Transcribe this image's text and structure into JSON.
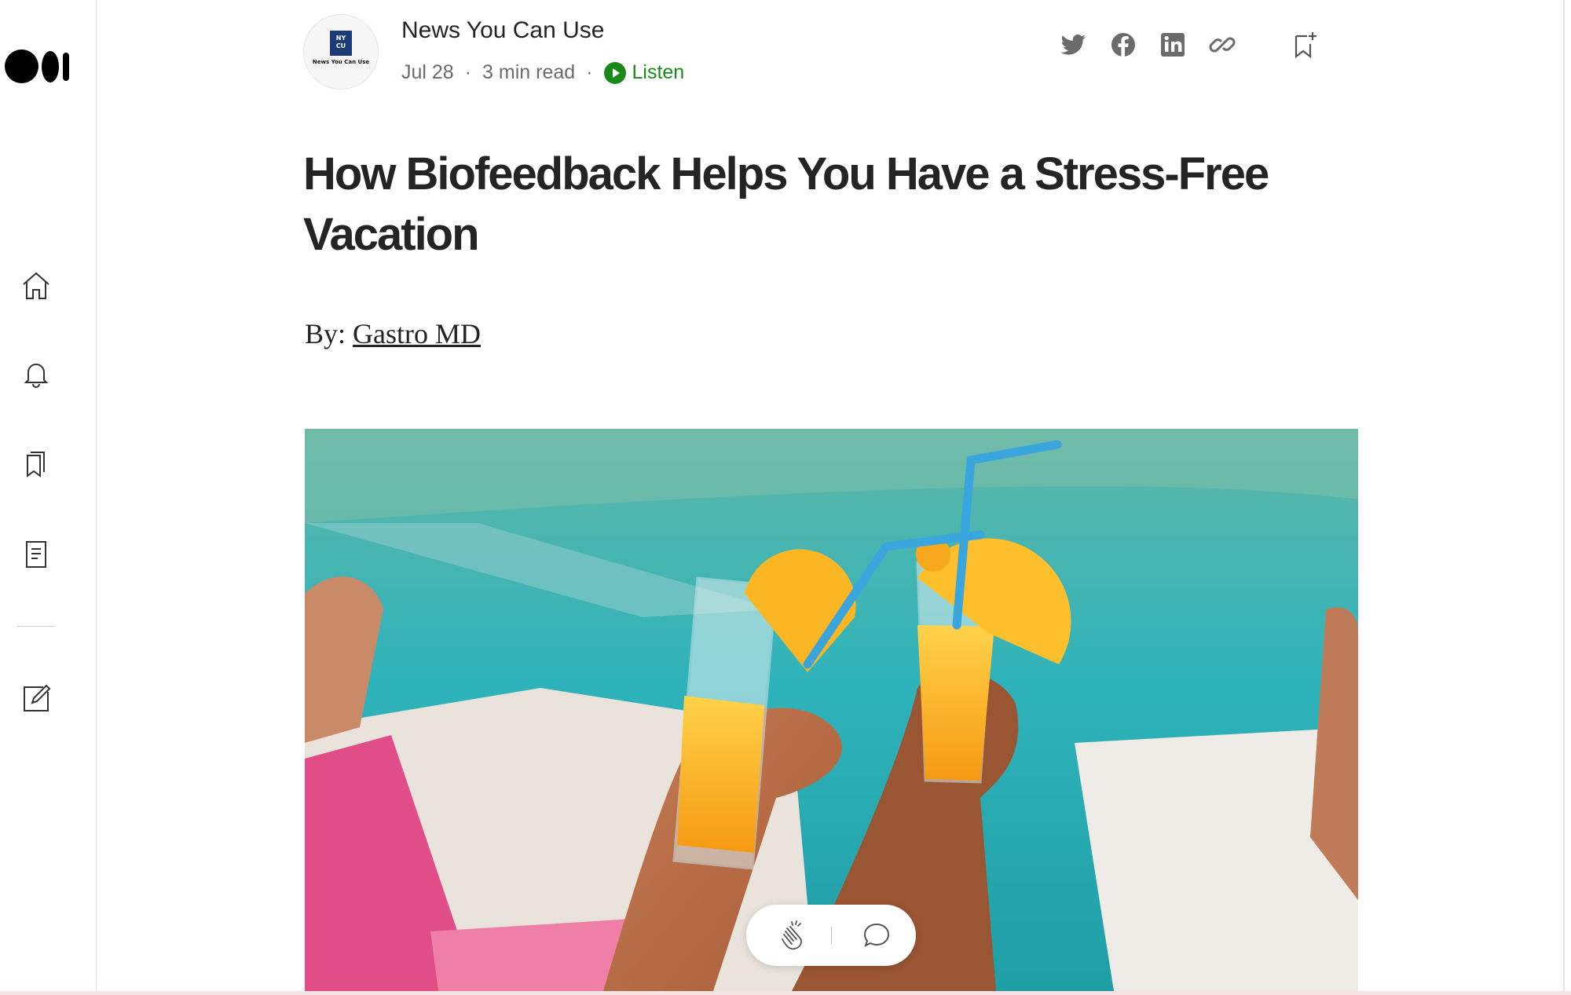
{
  "publication": {
    "name": "News You Can Use",
    "avatar_text_top": "NY",
    "avatar_text_bottom": "CU",
    "avatar_caption": "News You Can Use",
    "date": "Jul 28",
    "read_time": "3 min read",
    "separator": "·",
    "listen_label": "Listen"
  },
  "article": {
    "title": "How Biofeedback Helps You Have a Stress-Free Vacation",
    "byline_prefix": "By: ",
    "author": "Gastro MD"
  },
  "sidebar": {
    "items": [
      {
        "name": "home",
        "icon": "home-icon"
      },
      {
        "name": "notifications",
        "icon": "bell-icon"
      },
      {
        "name": "lists",
        "icon": "bookmarks-icon"
      },
      {
        "name": "stories",
        "icon": "document-icon"
      },
      {
        "name": "write",
        "icon": "edit-icon"
      }
    ]
  },
  "share_icons": [
    "twitter-icon",
    "facebook-icon",
    "linkedin-icon",
    "link-icon",
    "bookmark-add-icon"
  ],
  "colors": {
    "accent_green": "#1a8917",
    "text": "#242424",
    "muted": "#6b6b6b",
    "pool": "#3fb5b8",
    "juice": "#f6a21a",
    "straw": "#3aa6dd"
  }
}
